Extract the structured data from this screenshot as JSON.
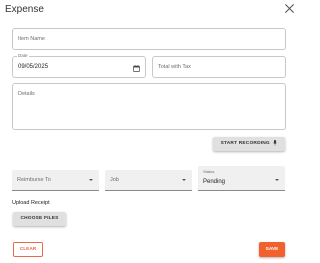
{
  "dialog": {
    "title": "Expense"
  },
  "form": {
    "item_name": {
      "placeholder": "Item Name",
      "value": ""
    },
    "date": {
      "label": "Date",
      "value": "09/05/2025"
    },
    "total_with_tax": {
      "placeholder": "Total with Tax",
      "value": ""
    },
    "details": {
      "placeholder": "Details",
      "value": ""
    },
    "reimburse_to": {
      "placeholder": "Reimburse To",
      "value": ""
    },
    "job": {
      "placeholder": "Job",
      "value": ""
    },
    "status": {
      "label": "Status",
      "value": "Pending"
    }
  },
  "buttons": {
    "start_recording": "START RECORDING",
    "choose_files": "CHOOSE FILES",
    "clear": "CLEAR",
    "save": "SAVE"
  },
  "upload": {
    "label": "Upload Receipt"
  },
  "icons": {
    "close": "close-icon",
    "calendar": "calendar-icon",
    "microphone": "microphone-icon",
    "dropdown": "chevron-down-icon"
  },
  "colors": {
    "accent": "#f2612b",
    "outline_accent": "#e86a48"
  }
}
